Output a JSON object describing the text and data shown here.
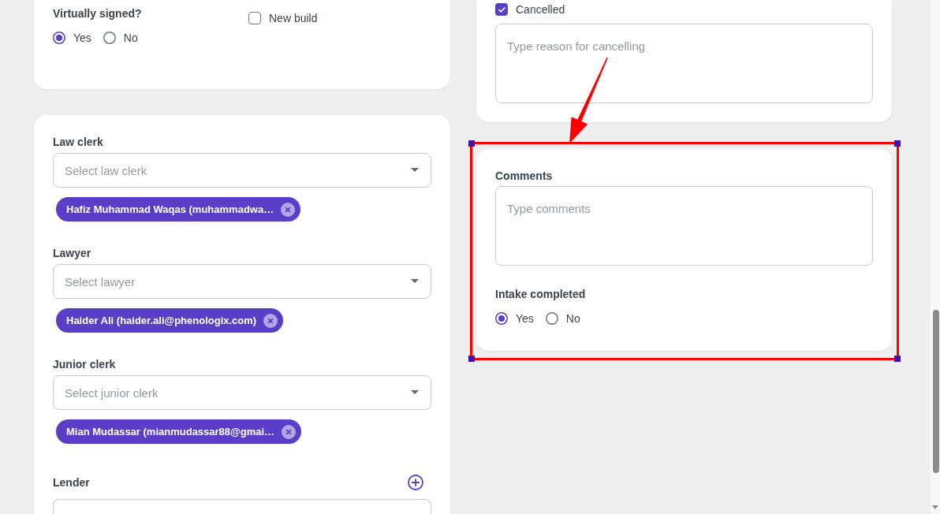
{
  "signing_card": {
    "virtually_signed": {
      "label": "Virtually signed?",
      "options": [
        {
          "label": "Yes",
          "selected": true
        },
        {
          "label": "No",
          "selected": false
        }
      ]
    },
    "new_build": {
      "label": "New build",
      "checked": false
    }
  },
  "staff_card": {
    "fields": [
      {
        "label": "Law clerk",
        "placeholder": "Select law clerk",
        "chips": [
          "Hafiz Muhammad Waqas (muhammadwa…"
        ]
      },
      {
        "label": "Lawyer",
        "placeholder": "Select lawyer",
        "chips": [
          "Haider Ali (haider.ali@phenologix.com)"
        ]
      },
      {
        "label": "Junior clerk",
        "placeholder": "Select junior clerk",
        "chips": [
          "Mian Mudassar (mianmudassar88@gmai…"
        ]
      }
    ],
    "lender": {
      "label": "Lender"
    }
  },
  "cancel_card": {
    "cancelled": {
      "label": "Cancelled",
      "checked": true
    },
    "reason": {
      "placeholder": "Type reason for cancelling"
    }
  },
  "comments_card": {
    "highlighted": true,
    "comments": {
      "label": "Comments",
      "placeholder": "Type comments"
    },
    "intake_completed": {
      "label": "Intake completed",
      "options": [
        {
          "label": "Yes",
          "selected": true
        },
        {
          "label": "No",
          "selected": false
        }
      ]
    }
  }
}
